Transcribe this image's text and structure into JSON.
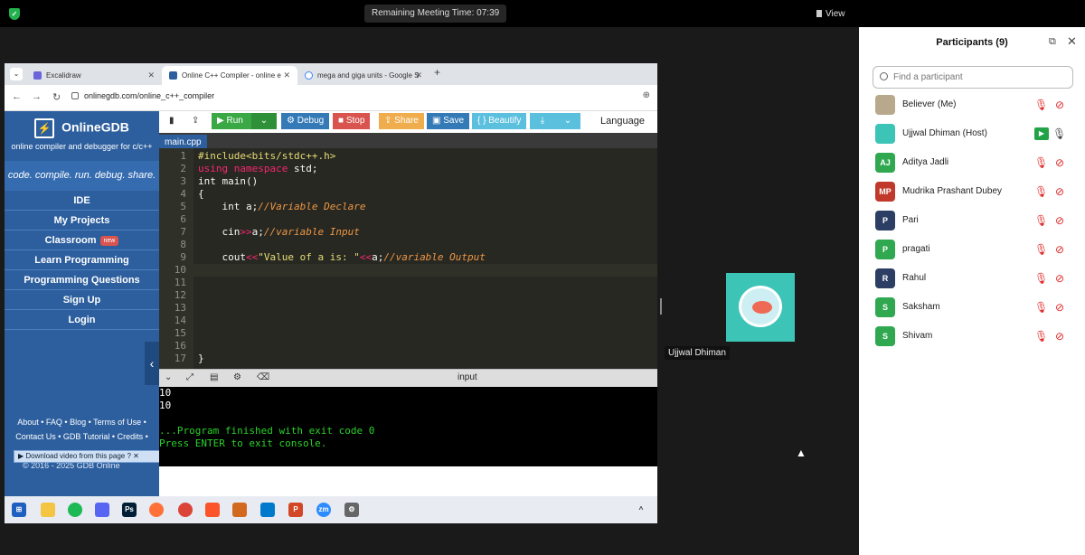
{
  "meeting": {
    "remaining_time": "Remaining Meeting Time: 07:39",
    "view_label": "View",
    "video_tile_name": "Ujjwal Dhiman"
  },
  "browser": {
    "tabs": [
      {
        "label": "Excalidraw"
      },
      {
        "label": "Online C++ Compiler - online e"
      },
      {
        "label": "mega and giga units - Google S"
      }
    ],
    "url": "onlinegdb.com/online_c++_compiler"
  },
  "gdb": {
    "logo": "OnlineGDB",
    "subtitle": "online compiler and debugger for c/c++",
    "tagline": "code. compile. run. debug. share.",
    "nav": [
      "IDE",
      "My Projects",
      "Classroom",
      "Learn Programming",
      "Programming Questions",
      "Sign Up",
      "Login"
    ],
    "new_badge": "new",
    "footer_line1": "About • FAQ • Blog • Terms of Use •",
    "footer_line2": "Contact Us • GDB Tutorial • Credits •",
    "download_bar": "Download video from this page",
    "copyright": "© 2016 - 2025 GDB Online",
    "toolbar": {
      "run": "Run",
      "debug": "Debug",
      "stop": "Stop",
      "share": "Share",
      "save": "Save",
      "beautify": "{ } Beautify",
      "language": "Language"
    },
    "file_tab": "main.cpp",
    "code_lines": [
      "#include<bits/stdc++.h>",
      "using namespace std;",
      "int main()",
      "{",
      "    int a;//Variable Declare",
      "",
      "    cin>>a;//variable Input",
      "",
      "    cout<<\"Value of a is: \"<<a;//variable Output",
      "",
      "",
      "",
      "",
      "",
      "",
      "",
      "}"
    ],
    "console_label": "input",
    "console_lines": [
      "10",
      "10",
      "",
      "...Program finished with exit code 0",
      "Press ENTER to exit console."
    ]
  },
  "participants": {
    "title": "Participants (9)",
    "search_placeholder": "Find a participant",
    "list": [
      {
        "initials": "",
        "name": "Believer (Me)",
        "color": "#b9a98c"
      },
      {
        "initials": "",
        "name": "Ujjwal Dhiman (Host)",
        "color": "#3cc4b6"
      },
      {
        "initials": "AJ",
        "name": "Aditya Jadli",
        "color": "#2fa84f"
      },
      {
        "initials": "MP",
        "name": "Mudrika Prashant Dubey",
        "color": "#c0392b"
      },
      {
        "initials": "P",
        "name": "Pari",
        "color": "#2c3e63"
      },
      {
        "initials": "P",
        "name": "pragati",
        "color": "#2fa84f"
      },
      {
        "initials": "R",
        "name": "Rahul",
        "color": "#2c3e63"
      },
      {
        "initials": "S",
        "name": "Saksham",
        "color": "#2fa84f"
      },
      {
        "initials": "S",
        "name": "Shivam",
        "color": "#2fa84f"
      }
    ]
  }
}
